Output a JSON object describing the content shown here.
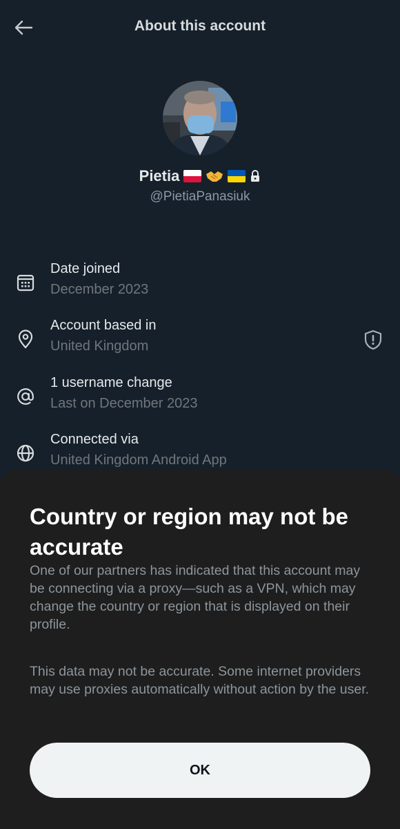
{
  "header": {
    "title": "About this account",
    "back_icon": "arrow-left-icon"
  },
  "profile": {
    "display_name": "Pietia",
    "name_emojis": [
      "poland-flag",
      "handshake-emoji",
      "ukraine-flag"
    ],
    "protected_icon": "lock-icon",
    "handle": "@PietiaPanasiuk"
  },
  "info": [
    {
      "icon": "calendar-icon",
      "title": "Date joined",
      "subtitle": "December 2023"
    },
    {
      "icon": "location-pin-icon",
      "title": "Account based in",
      "subtitle": "United Kingdom",
      "action_icon": "shield-alert-icon"
    },
    {
      "icon": "at-sign-icon",
      "title": "1 username change",
      "subtitle": "Last on December 2023"
    },
    {
      "icon": "globe-icon",
      "title": "Connected via",
      "subtitle": "United Kingdom Android App"
    }
  ],
  "sheet": {
    "title": "Country or region may not be accurate",
    "paragraph1": "One of our partners has indicated that this account may be connecting via a proxy—such as a VPN, which may change the country or region that is displayed on their profile.",
    "paragraph2": "This data may not be accurate. Some internet providers may use proxies automatically without action by the user.",
    "ok_label": "OK"
  },
  "colors": {
    "background": "#15202b",
    "sheet_background": "#1e1e1e",
    "secondary_text": "#71767b",
    "button_background": "#eff3f4"
  }
}
